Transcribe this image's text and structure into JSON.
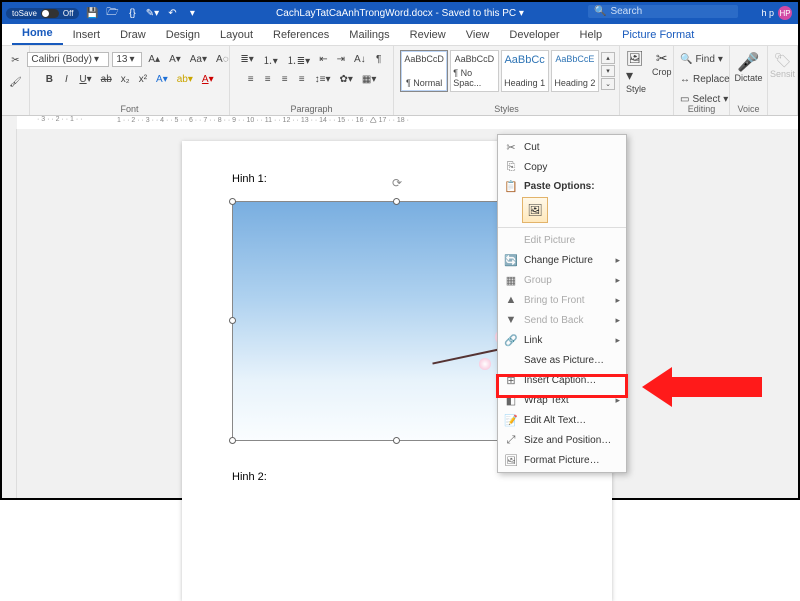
{
  "title": {
    "filename": "CachLayTatCaAnhTrongWord.docx",
    "status": "Saved to this PC"
  },
  "autosave": {
    "label": "toSave",
    "state": "Off"
  },
  "search": {
    "placeholder": "Search"
  },
  "user": {
    "name": "h p",
    "initials": "HP"
  },
  "tabs": [
    "Home",
    "Insert",
    "Draw",
    "Design",
    "Layout",
    "References",
    "Mailings",
    "Review",
    "View",
    "Developer",
    "Help",
    "Picture Format"
  ],
  "activeTab": "Home",
  "font": {
    "name": "Calibri (Body)",
    "size": "13"
  },
  "styleCards": [
    {
      "preview": "AaBbCcD",
      "name": "¶ Normal"
    },
    {
      "preview": "AaBbCcD",
      "name": "¶ No Spac..."
    },
    {
      "preview": "AaBbCc",
      "name": "Heading 1"
    },
    {
      "preview": "AaBbCcE",
      "name": "Heading 2"
    }
  ],
  "pictureTools": {
    "style": "Style",
    "crop": "Crop"
  },
  "editing": {
    "find": "Find",
    "replace": "Replace",
    "select": "Select"
  },
  "voice": {
    "dictate": "Dictate"
  },
  "sens": {
    "label": "Sensit"
  },
  "groupLabels": {
    "font": "Font",
    "paragraph": "Paragraph",
    "styles": "Styles",
    "editing": "Editing",
    "voice": "Voice"
  },
  "captions": {
    "h1": "Hinh 1:",
    "h2": "Hinh 2:"
  },
  "ctx": {
    "cut": "Cut",
    "copy": "Copy",
    "pasteHeading": "Paste Options:",
    "editPic": "Edit Picture",
    "changePic": "Change Picture",
    "group": "Group",
    "bringFront": "Bring to Front",
    "sendBack": "Send to Back",
    "link": "Link",
    "savePic": "Save as Picture…",
    "insertCap": "Insert Caption…",
    "wrap": "Wrap Text",
    "altText": "Edit Alt Text…",
    "sizePos": "Size and Position…",
    "fmtPic": "Format Picture…"
  }
}
